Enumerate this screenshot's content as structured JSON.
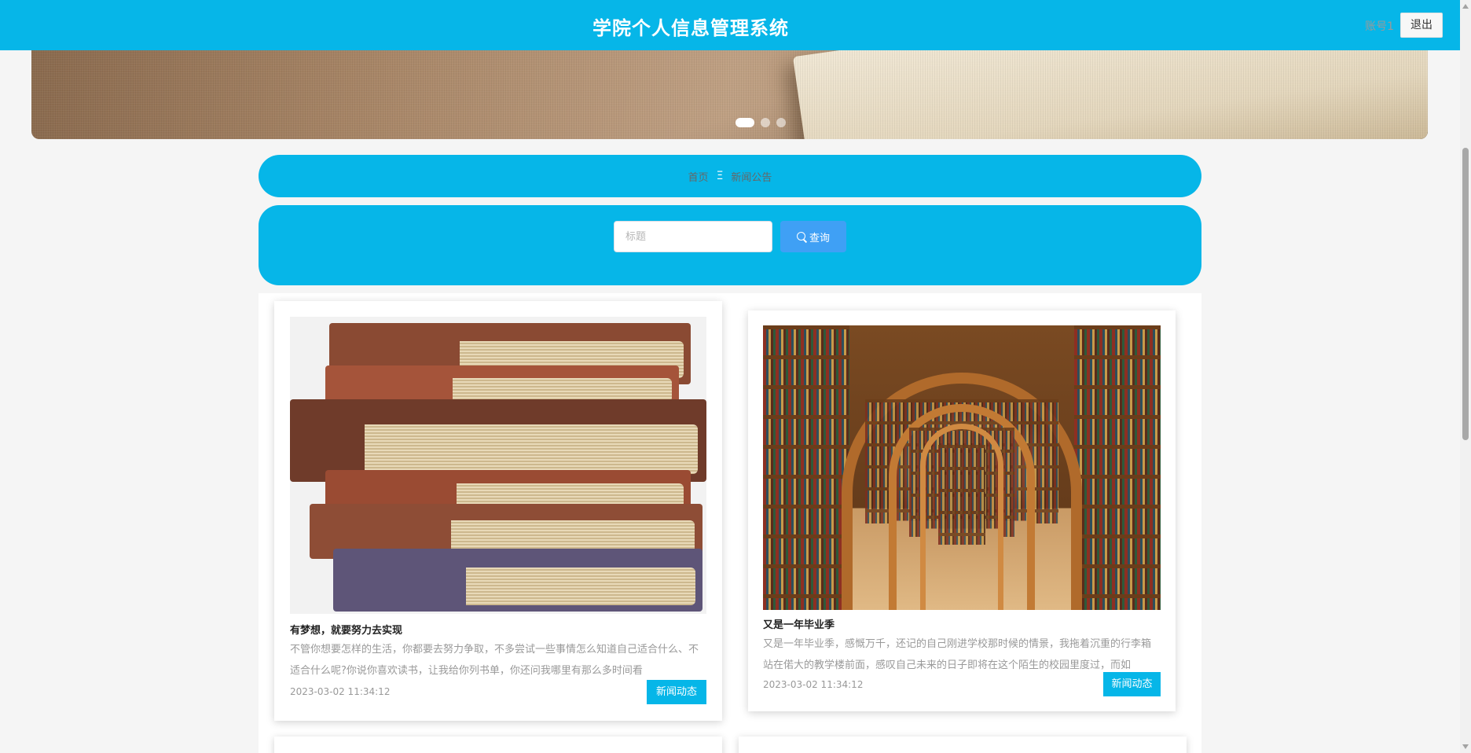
{
  "header": {
    "title": "学院个人信息管理系统",
    "account": "账号1",
    "logout_label": "退出"
  },
  "banner": {
    "slide_count": 3,
    "active_slide": 1
  },
  "breadcrumb": {
    "home": "首页",
    "separator": "Ξ",
    "current": "新闻公告"
  },
  "search": {
    "placeholder": "标题",
    "value": "",
    "button_label": "查询",
    "button_icon": "search-icon"
  },
  "news": [
    {
      "title": "有梦想，就要努力去实现",
      "summary": "不管你想要怎样的生活，你都要去努力争取，不多尝试一些事情怎么知道自己适合什么、不适合什么呢?你说你喜欢读书，让我给你列书单，你还问我哪里有那么多时间看",
      "date": "2023-03-02 11:34:12",
      "tag": "新闻动态",
      "image": "stacked-books"
    },
    {
      "title": "又是一年毕业季",
      "summary": "又是一年毕业季，感慨万千，还记的自己刚进学校那时候的情景，我拖着沉重的行李箱站在偌大的教学楼前面，感叹自己未来的日子即将在这个陌生的校园里度过，而如",
      "date": "2023-03-02 11:34:12",
      "tag": "新闻动态",
      "image": "library-arches"
    }
  ],
  "colors": {
    "primary": "#06b6e8",
    "button": "#3fa0f5",
    "background": "#f5f5f5"
  }
}
